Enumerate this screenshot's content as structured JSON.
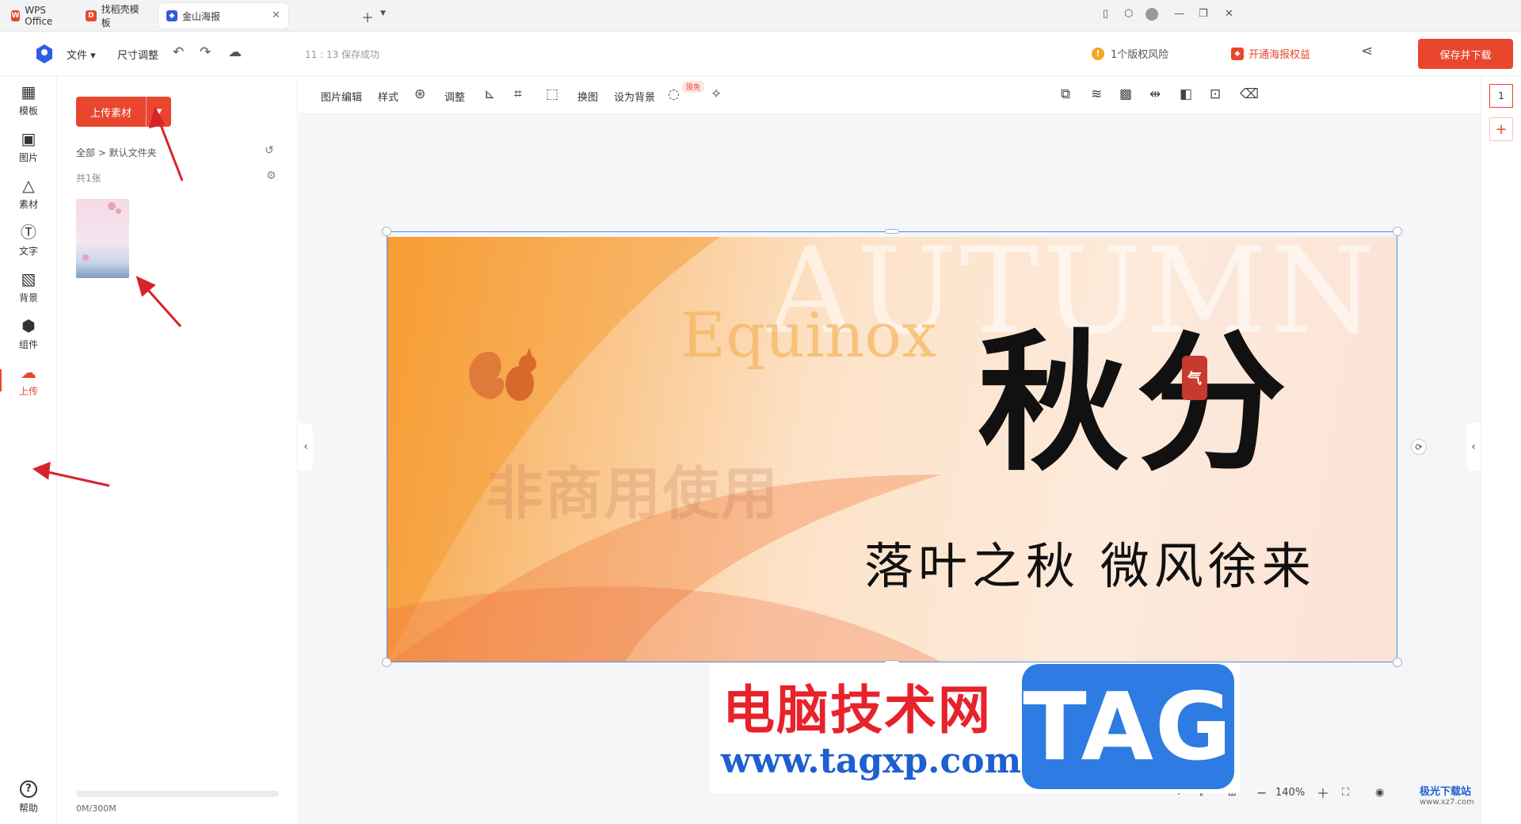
{
  "tabs": [
    {
      "label": "WPS Office"
    },
    {
      "label": "找稻壳模板"
    },
    {
      "label": "金山海报"
    }
  ],
  "topbar": {
    "file_menu": "文件",
    "resize": "尺寸调整",
    "save_status": "11 : 13 保存成功",
    "copyright_risk": "1个版权风险",
    "vip": "开通海报权益",
    "save_download": "保存并下载"
  },
  "leftnav": {
    "items": [
      {
        "label": "模板",
        "icon": "template-icon"
      },
      {
        "label": "图片",
        "icon": "image-icon"
      },
      {
        "label": "素材",
        "icon": "material-icon"
      },
      {
        "label": "文字",
        "icon": "text-icon"
      },
      {
        "label": "背景",
        "icon": "background-icon"
      },
      {
        "label": "组件",
        "icon": "component-icon"
      },
      {
        "label": "上传",
        "icon": "upload-cloud-icon"
      }
    ],
    "active_index": 6,
    "help": "帮助"
  },
  "panel": {
    "upload_button": "上传素材",
    "breadcrumb": "全部 > 默认文件夹",
    "count": "共1张",
    "storage_used": 0,
    "storage_text": "0M/300M"
  },
  "canvas_toolbar": {
    "image_edit": "图片编辑",
    "style": "样式",
    "adjust": "调整",
    "change_image": "换图",
    "set_background": "设为背景",
    "limit_free": "限免"
  },
  "poster": {
    "bg_word": "AUTUMN",
    "equinox": "Equinox",
    "watermark": "非商用使用",
    "title": "秋分",
    "seal": "气",
    "slogan": "落叶之秋 微风徐来"
  },
  "overlay": {
    "site_cn": "电脑技术网",
    "site_url": "www.tagxp.com",
    "tag": "TAG",
    "xz_name": "极光下载站",
    "xz_url": "www.xz7.com"
  },
  "zoom": {
    "level": "140%"
  },
  "pages": {
    "current": "1",
    "add": "+"
  },
  "colors": {
    "accent": "#e9462e",
    "selection": "#4a8cf0"
  }
}
